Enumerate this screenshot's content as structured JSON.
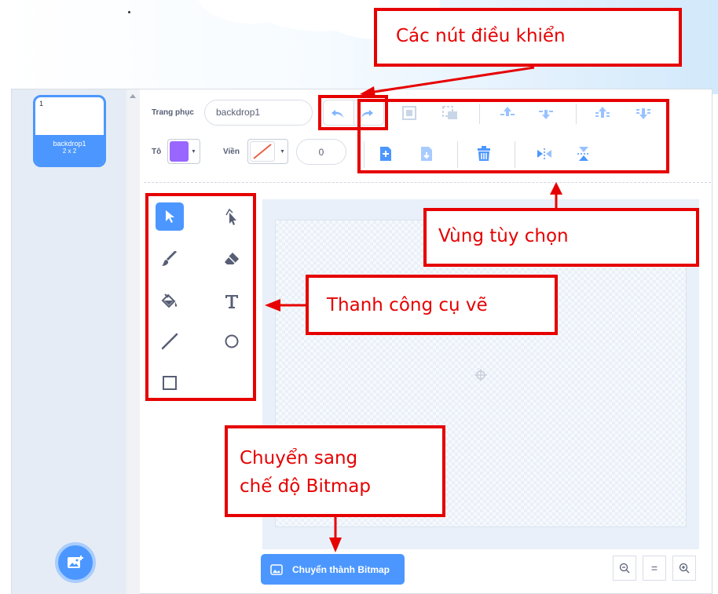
{
  "annotations": {
    "controls": "Các nút điều khiển",
    "options": "Vùng tùy chọn",
    "toolbar": "Thanh công cụ vẽ",
    "bitmap_line1": "Chuyển sang",
    "bitmap_line2": "chế độ Bitmap"
  },
  "costume_list": {
    "items": [
      {
        "number": "1",
        "name": "backdrop1",
        "size": "2 x 2"
      }
    ],
    "add_icon": "add-backdrop-icon"
  },
  "toolbar": {
    "costume_label": "Trang phục",
    "costume_name": "backdrop1",
    "fill_label": "Tô",
    "fill_color": "#9966ff",
    "outline_label": "Viền",
    "outline_width": "0"
  },
  "tools": [
    "select",
    "reshape",
    "brush",
    "eraser",
    "fill",
    "text",
    "line",
    "circle",
    "rectangle"
  ],
  "bitmap_button": "Chuyển thành Bitmap",
  "zoom": {
    "reset": "="
  },
  "colors": {
    "accent": "#4c97ff",
    "annotation": "#e60000",
    "text": "#575e75"
  }
}
